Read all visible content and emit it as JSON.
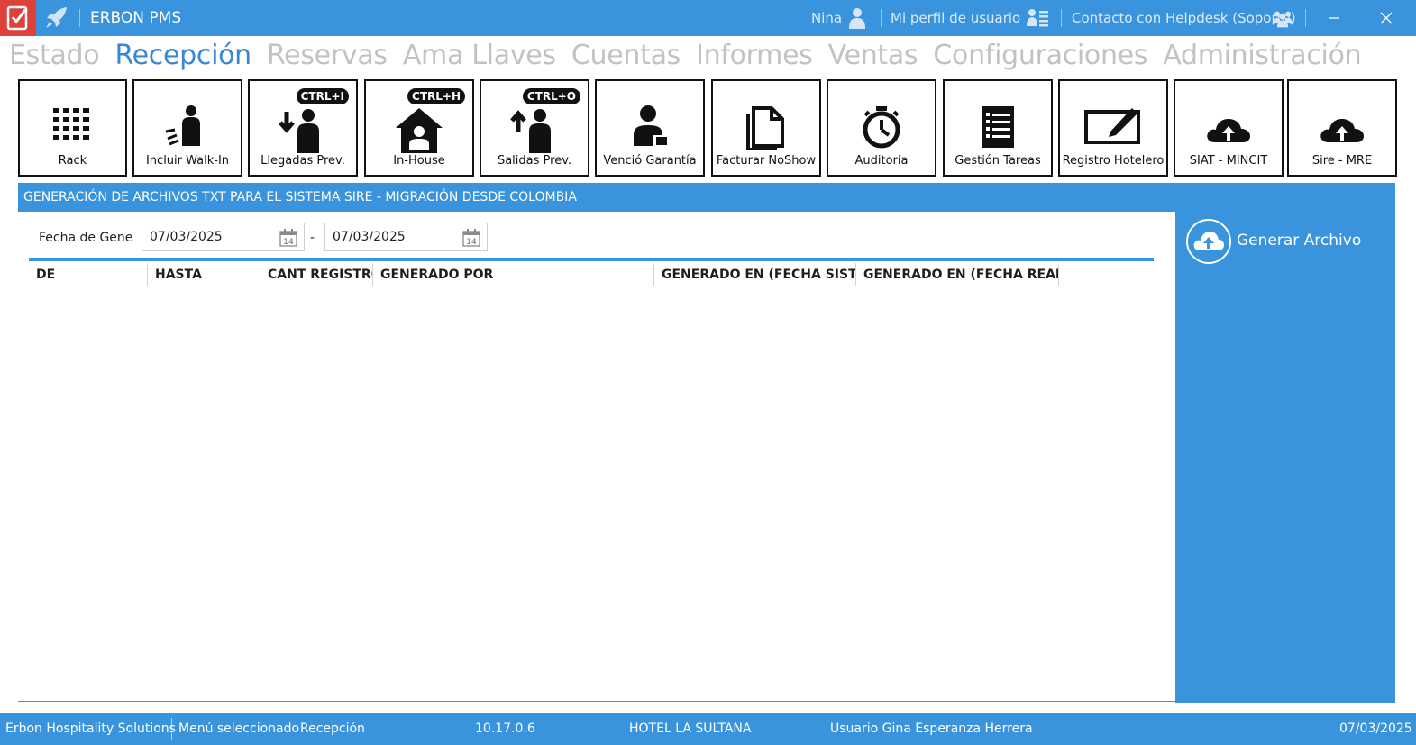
{
  "titlebar": {
    "app_title": "ERBON PMS",
    "user_name": "Nina",
    "profile_label": "Mi perfil de usuario",
    "helpdesk_label": "Contacto con Helpdesk (Soporte)"
  },
  "menu": {
    "items": [
      "Estado",
      "Recepción",
      "Reservas",
      "Ama Llaves",
      "Cuentas",
      "Informes",
      "Ventas",
      "Configuraciones",
      "Administración"
    ],
    "active": "Recepción"
  },
  "toolbar": {
    "buttons": [
      {
        "label": "Rack",
        "icon": "grid-icon"
      },
      {
        "label": "Incluir Walk-In",
        "icon": "walk-in-icon"
      },
      {
        "label": "Llegadas Prev.",
        "icon": "arrival-icon",
        "shortcut": "CTRL+I"
      },
      {
        "label": "In-House",
        "icon": "house-icon",
        "shortcut": "CTRL+H"
      },
      {
        "label": "Salidas Prev.",
        "icon": "departure-icon",
        "shortcut": "CTRL+O"
      },
      {
        "label": "Venció Garantía",
        "icon": "guarantee-icon"
      },
      {
        "label": "Facturar NoShow",
        "icon": "document-icon"
      },
      {
        "label": "Auditoria",
        "icon": "stopwatch-icon"
      },
      {
        "label": "Gestión Tareas",
        "icon": "task-list-icon"
      },
      {
        "label": "Registro Hotelero",
        "icon": "edit-icon"
      },
      {
        "label": "SIAT - MINCIT",
        "icon": "cloud-upload-icon"
      },
      {
        "label": "Sire - MRE",
        "icon": "cloud-upload-icon"
      }
    ]
  },
  "panel": {
    "title": "GENERACIÓN DE ARCHIVOS TXT PARA EL SISTEMA SIRE - MIGRACIÓN DESDE COLOMBIA",
    "filter_label": "Fecha de Generación",
    "date_from": "07/03/2025",
    "date_to": "07/03/2025",
    "separator": "-",
    "calendar_day": "14",
    "generate_label": "Generar Archivo",
    "columns": [
      "DE",
      "HASTA",
      "CANT REGISTROS",
      "GENERADO POR",
      "GENERADO EN (FECHA SISTEMA)",
      "GENERADO EN (FECHA REAL)"
    ]
  },
  "statusbar": {
    "company": "Erbon Hospitality Solutions",
    "menu_selected_label": "Menú seleccionado",
    "menu_selected_value": "Recepción",
    "version": "10.17.0.6",
    "hotel": "HOTEL LA SULTANA",
    "user": "Usuario Gina Esperanza Herrera",
    "date": "07/03/2025"
  },
  "colors": {
    "primary": "#3a93dd",
    "menu_active": "#3a86d6",
    "menu_inactive": "#c2c2c2",
    "app_icon": "#e0403a"
  }
}
